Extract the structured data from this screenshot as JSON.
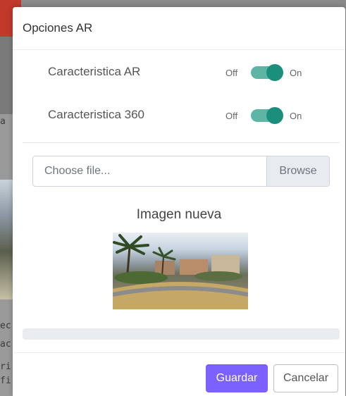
{
  "background": {
    "text_fragments": [
      "a",
      "ec",
      "ac",
      "ri",
      "fi"
    ]
  },
  "modal": {
    "title": "Opciones AR",
    "toggles": [
      {
        "label": "Caracteristica AR",
        "off_label": "Off",
        "on_label": "On",
        "state": "on"
      },
      {
        "label": "Caracteristica 360",
        "off_label": "Off",
        "on_label": "On",
        "state": "on"
      }
    ],
    "file_input": {
      "placeholder": "Choose file...",
      "browse_label": "Browse"
    },
    "image_title": "Imagen nueva",
    "progress": 0,
    "buttons": {
      "save": "Guardar",
      "cancel": "Cancelar"
    }
  },
  "colors": {
    "accent": "#7b61ff",
    "toggle_track": "#5fb5a5",
    "toggle_knob": "#1b8f7c",
    "header_bar": "#c0392b"
  }
}
